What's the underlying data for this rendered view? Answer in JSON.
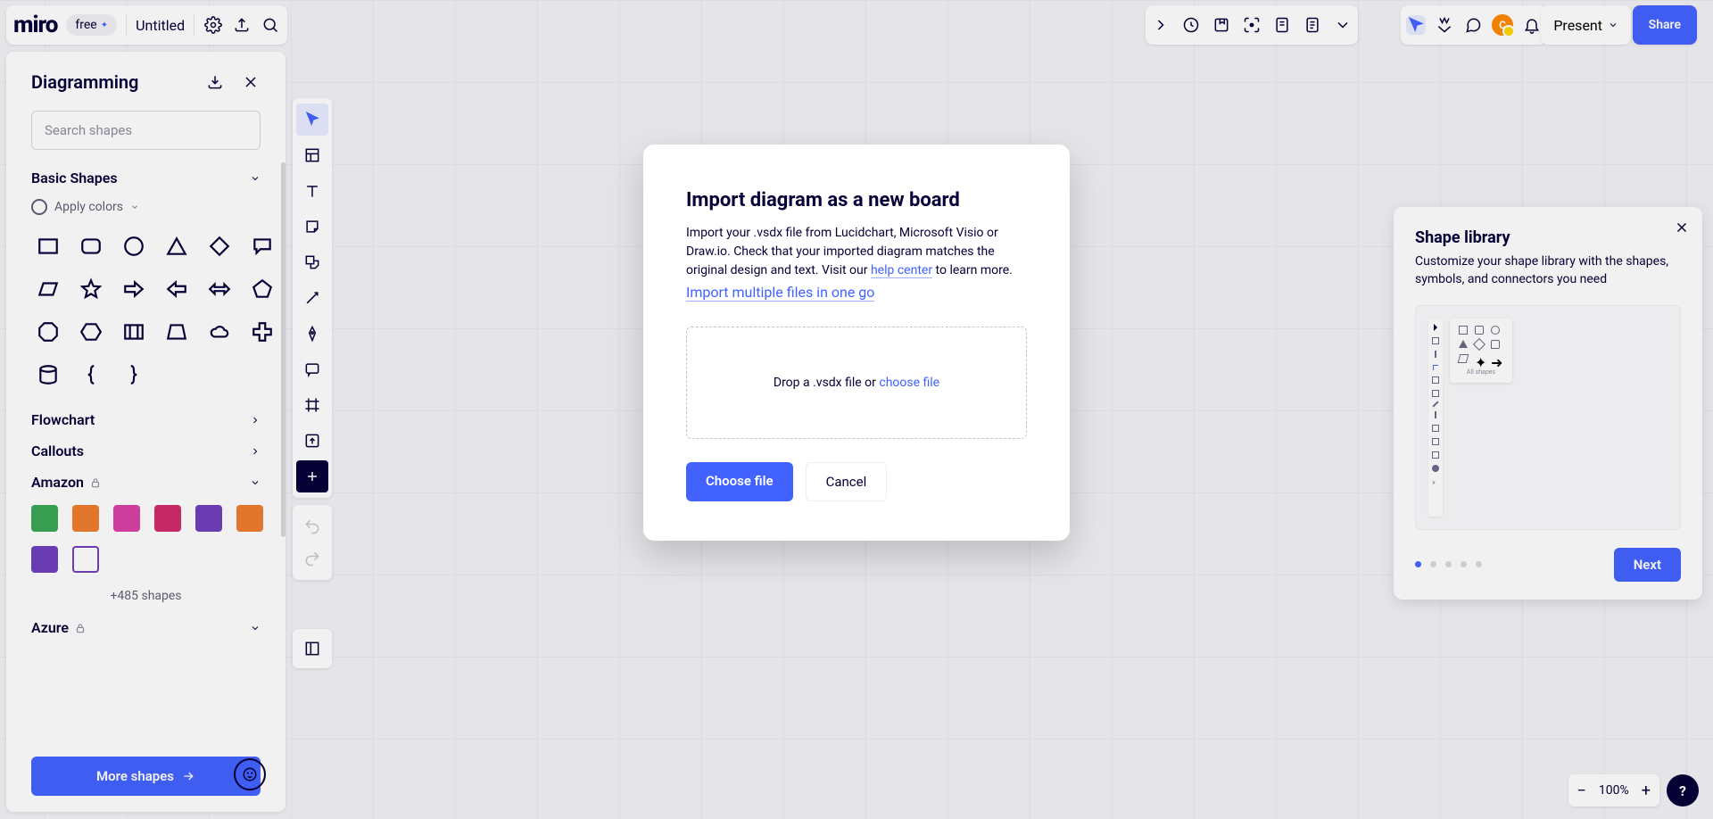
{
  "header": {
    "logo": "miro",
    "plan": "free",
    "title": "Untitled",
    "present": "Present",
    "share": "Share"
  },
  "panel": {
    "title": "Diagramming",
    "search_placeholder": "Search shapes",
    "apply_colors": "Apply colors",
    "categories": {
      "basic": "Basic Shapes",
      "flowchart": "Flowchart",
      "callouts": "Callouts",
      "amazon": "Amazon",
      "azure": "Azure"
    },
    "more_count": "+485 shapes",
    "more_shapes": "More shapes"
  },
  "modal": {
    "title": "Import diagram as a new board",
    "body1": "Import your .vsdx file from Lucidchart, Microsoft Visio or Draw.io. Check that your imported diagram matches the original design and text. Visit our ",
    "help_center": "help center",
    "body2": " to learn more.",
    "multi_link": "Import multiple files in one go",
    "drop_text": "Drop a .vsdx file or ",
    "choose_inline": "choose file",
    "choose_btn": "Choose file",
    "cancel_btn": "Cancel"
  },
  "library": {
    "title": "Shape library",
    "body": "Customize your shape library with the shapes, symbols, and connectors you need",
    "popup_label": "All shapes",
    "next": "Next"
  },
  "zoom": {
    "level": "100%"
  },
  "avatar": "C"
}
